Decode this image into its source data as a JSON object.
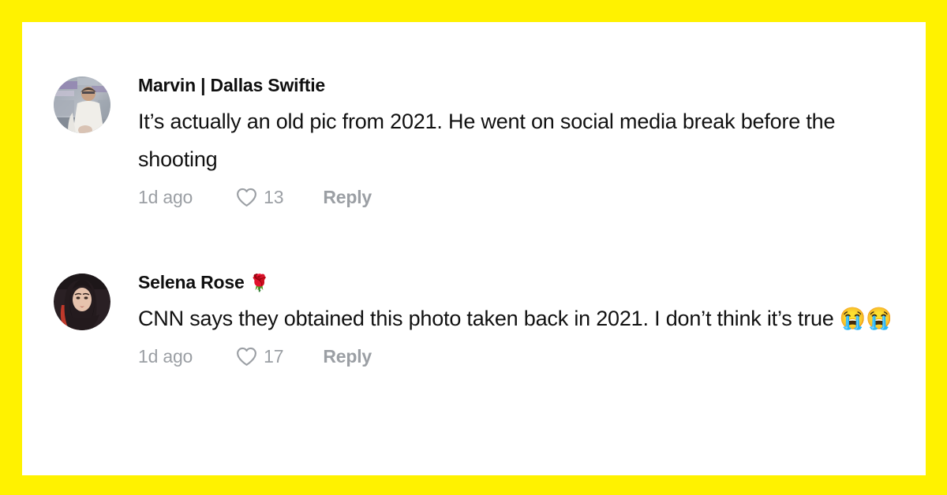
{
  "theme": {
    "border_color": "#FFF200",
    "card_background": "#FFFFFF",
    "primary_text_color": "#111111",
    "muted_text_color": "#9B9FA4"
  },
  "comments": [
    {
      "username": "Marvin | Dallas Swiftie",
      "username_emoji": "",
      "text": "It’s actually an old pic from 2021. He went on social media break before the shooting",
      "time": "1d ago",
      "like_icon": "heart-outline-icon",
      "likes": "13",
      "reply_label": "Reply",
      "avatar": "photo-of-man-in-white-shirt-at-arena"
    },
    {
      "username": "Selena Rose",
      "username_emoji": "🌹",
      "text": "CNN says they obtained this photo taken back in 2021. I don’t think it’s true 😭😭",
      "time": "1d ago",
      "like_icon": "heart-outline-icon",
      "likes": "17",
      "reply_label": "Reply",
      "avatar": "photo-of-woman-with-dark-hair-in-red-top"
    }
  ]
}
